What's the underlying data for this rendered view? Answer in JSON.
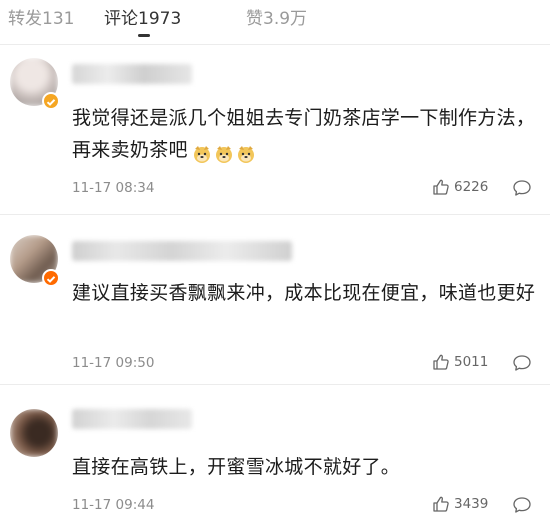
{
  "tabs": [
    {
      "label": "转发131",
      "active": false
    },
    {
      "label": "评论1973",
      "active": true
    },
    {
      "label": "赞3.9万",
      "active": false
    }
  ],
  "comments": [
    {
      "text": "我觉得还是派几个姐姐去专门奶茶店学一下制作方法，再来卖奶茶吧",
      "emoji": [
        "doge-emoji",
        "doge-emoji",
        "doge-emoji"
      ],
      "time": "11-17 08:34",
      "likes": "6226"
    },
    {
      "text": "建议直接买香飘飘来冲，成本比现在便宜，味道也更好",
      "time": "11-17 09:50",
      "likes": "5011"
    },
    {
      "text": "直接在高铁上，开蜜雪冰城不就好了。",
      "time": "11-17 09:44",
      "likes": "3439"
    }
  ],
  "colors": {
    "active_tab": "#333333",
    "inactive_tab": "#9a9a9a",
    "verified_badge": "#f5a623",
    "meta": "#8c8c8c"
  }
}
